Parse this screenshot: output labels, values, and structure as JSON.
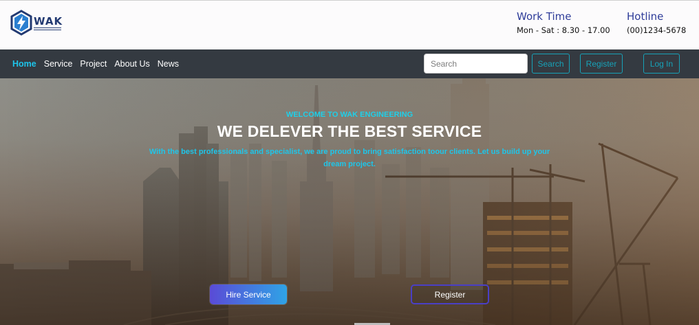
{
  "header": {
    "logo_word": "WAK",
    "work_time": {
      "title": "Work Time",
      "value": "Mon - Sat : 8.30 - 17.00"
    },
    "hotline": {
      "title": "Hotline",
      "value": "(00)1234-5678"
    }
  },
  "nav": {
    "items": [
      {
        "label": "Home",
        "active": true
      },
      {
        "label": "Service",
        "active": false
      },
      {
        "label": "Project",
        "active": false
      },
      {
        "label": "About Us",
        "active": false
      },
      {
        "label": "News",
        "active": false
      }
    ],
    "search_placeholder": "Search",
    "search_button": "Search",
    "register_button": "Register",
    "login_button": "Log In"
  },
  "hero": {
    "kicker": "WELCOME TO WAK ENGINEERING",
    "title": "WE DELEVER THE BEST SERVICE",
    "description": "With the best professionals and specialist, we are proud to bring satisfaction toour clients. Let us build up your dream project.",
    "hire_button": "Hire Service",
    "register_button": "Register"
  },
  "colors": {
    "accent": "#1ec4ea",
    "nav_bg": "#343a41",
    "brand": "#233a72",
    "info_title": "#2e3c99",
    "outline_button": "#17a2b8"
  }
}
